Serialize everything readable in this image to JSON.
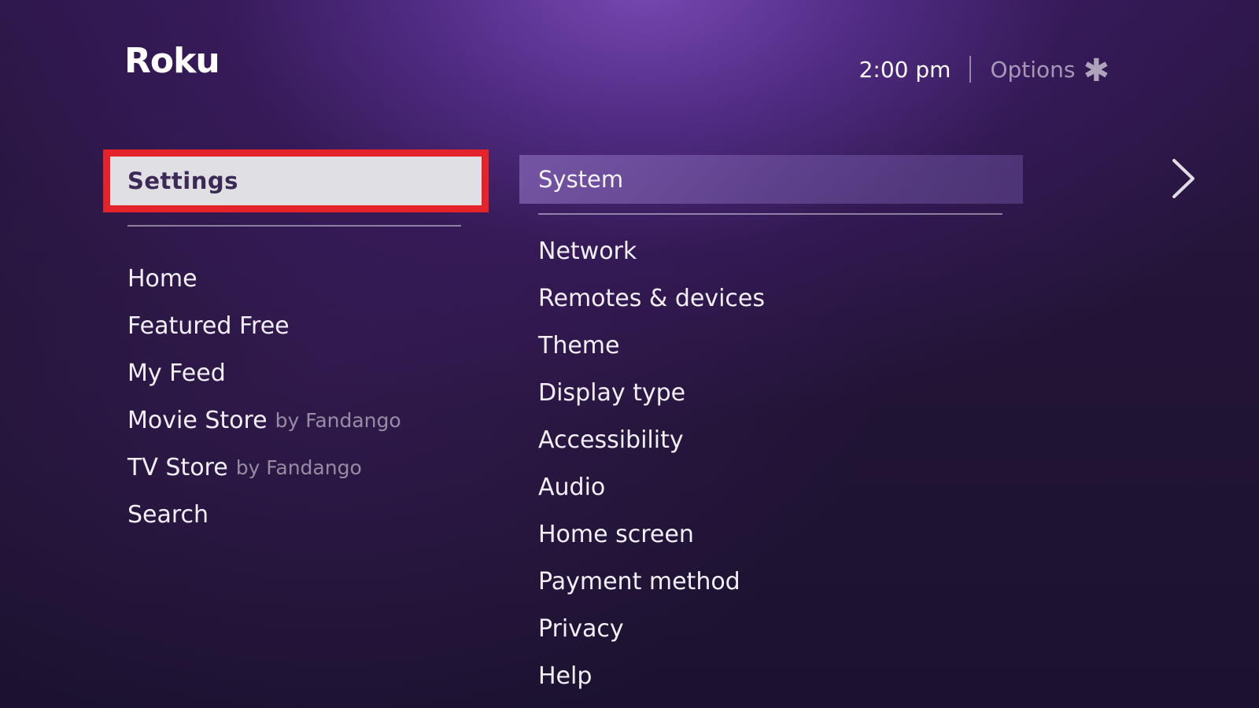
{
  "header": {
    "logo_text": "Roku",
    "time": "2:00 pm",
    "options_label": "Options",
    "options_icon": "asterisk-icon"
  },
  "left_menu": {
    "selected": "Settings",
    "items": [
      {
        "label": "Home",
        "suffix": ""
      },
      {
        "label": "Featured Free",
        "suffix": ""
      },
      {
        "label": "My Feed",
        "suffix": ""
      },
      {
        "label": "Movie Store",
        "suffix": "by Fandango"
      },
      {
        "label": "TV Store",
        "suffix": "by Fandango"
      },
      {
        "label": "Search",
        "suffix": ""
      }
    ]
  },
  "right_menu": {
    "highlighted": "System",
    "items": [
      {
        "label": "Network"
      },
      {
        "label": "Remotes & devices"
      },
      {
        "label": "Theme"
      },
      {
        "label": "Display type"
      },
      {
        "label": "Accessibility"
      },
      {
        "label": "Audio"
      },
      {
        "label": "Home screen"
      },
      {
        "label": "Payment method"
      },
      {
        "label": "Privacy"
      },
      {
        "label": "Help"
      }
    ]
  },
  "colors": {
    "selection_border": "#e5232b",
    "selection_fill": "#e0dfe3",
    "background_top": "#7a4cb8",
    "background_bottom": "#1c1230"
  }
}
